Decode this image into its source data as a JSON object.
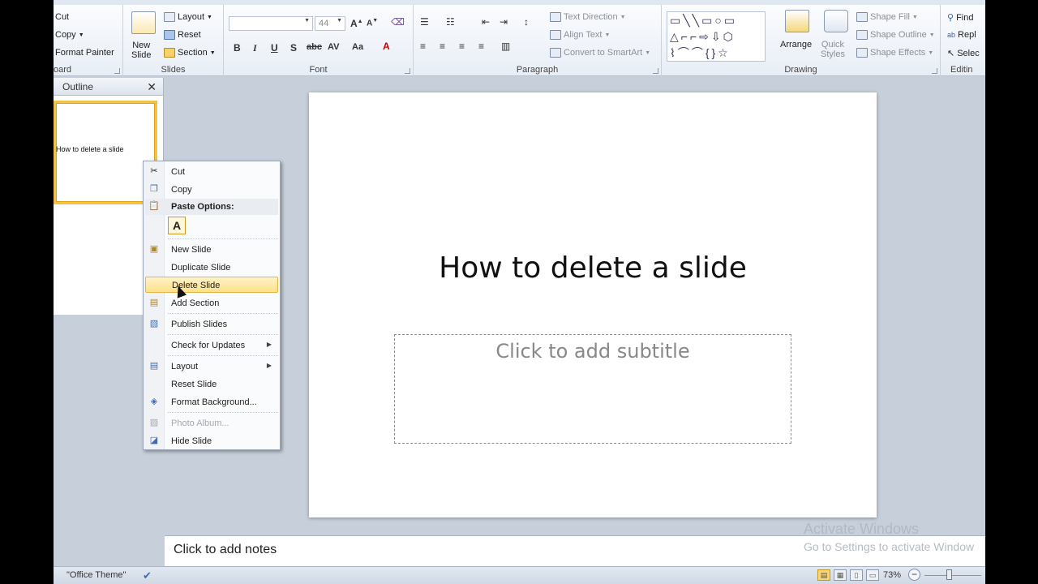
{
  "ribbon": {
    "clipboard": {
      "cut": "Cut",
      "copy": "Copy",
      "format_painter": "Format Painter",
      "group_label": "oard"
    },
    "slides": {
      "new_slide_l1": "New",
      "new_slide_l2": "Slide",
      "layout": "Layout",
      "reset": "Reset",
      "section": "Section",
      "group_label": "Slides"
    },
    "font": {
      "size": "44",
      "group_label": "Font"
    },
    "paragraph": {
      "text_direction": "Text Direction",
      "align_text": "Align Text",
      "convert_smartart": "Convert to SmartArt",
      "group_label": "Paragraph"
    },
    "drawing": {
      "arrange": "Arrange",
      "quick_styles_l1": "Quick",
      "quick_styles_l2": "Styles",
      "shape_fill": "Shape Fill",
      "shape_outline": "Shape Outline",
      "shape_effects": "Shape Effects",
      "group_label": "Drawing"
    },
    "editing": {
      "find": "Find",
      "replace": "Repl",
      "select": "Selec",
      "group_label": "Editin"
    }
  },
  "panel": {
    "tab": "Outline",
    "thumb_text": "How to delete a slide"
  },
  "slide": {
    "title": "How to delete a slide",
    "subtitle_placeholder": "Click to add subtitle"
  },
  "notes": {
    "placeholder": "Click to add notes"
  },
  "status": {
    "theme": "\"Office Theme\"",
    "zoom": "73%"
  },
  "watermark": {
    "line1": "Activate Windows",
    "line2": "Go to Settings to activate Window"
  },
  "context_menu": {
    "cut": "Cut",
    "copy": "Copy",
    "paste_options": "Paste Options:",
    "paste_keep_text": "A",
    "new_slide": "New Slide",
    "duplicate_slide": "Duplicate Slide",
    "delete_slide": "Delete Slide",
    "add_section": "Add Section",
    "publish_slides": "Publish Slides",
    "check_updates": "Check for Updates",
    "layout": "Layout",
    "reset_slide": "Reset Slide",
    "format_background": "Format Background...",
    "photo_album": "Photo Album...",
    "hide_slide": "Hide Slide"
  },
  "colors": {
    "highlight": "#ffe08a",
    "thumb_border": "#f0c24b",
    "workspace": "#c7cfda"
  }
}
